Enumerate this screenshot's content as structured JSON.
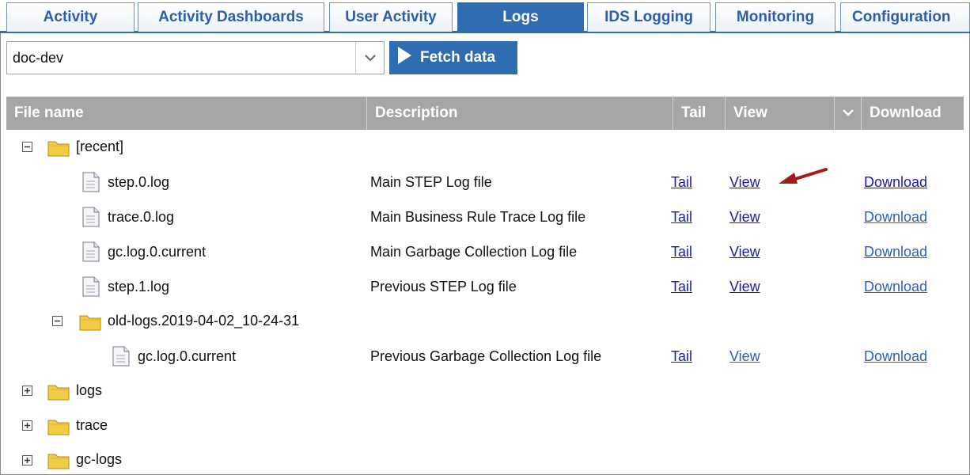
{
  "tabs": [
    {
      "label": "Activity",
      "active": false
    },
    {
      "label": "Activity Dashboards",
      "active": false
    },
    {
      "label": "User Activity",
      "active": false
    },
    {
      "label": "Logs",
      "active": true
    },
    {
      "label": "IDS Logging",
      "active": false
    },
    {
      "label": "Monitoring",
      "active": false
    },
    {
      "label": "Configuration",
      "active": false
    }
  ],
  "toolbar": {
    "server_value": "doc-dev",
    "fetch_label": "Fetch data"
  },
  "table": {
    "headers": {
      "file_name": "File name",
      "description": "Description",
      "tail": "Tail",
      "view": "View",
      "download": "Download"
    },
    "rows": [
      {
        "type": "folder",
        "expanded": true,
        "name": "[recent]"
      },
      {
        "type": "file",
        "name": "step.0.log",
        "description": "Main STEP Log file",
        "tail": "Tail",
        "view": "View",
        "download": "Download"
      },
      {
        "type": "file",
        "name": "trace.0.log",
        "description": "Main Business Rule Trace Log file",
        "tail": "Tail",
        "view": "View",
        "download": "Download"
      },
      {
        "type": "file",
        "name": "gc.log.0.current",
        "description": "Main Garbage Collection Log file",
        "tail": "Tail",
        "view": "View",
        "download": "Download"
      },
      {
        "type": "file",
        "name": "step.1.log",
        "description": "Previous STEP Log file",
        "tail": "Tail",
        "view": "View",
        "download": "Download"
      },
      {
        "type": "folder",
        "expanded": true,
        "name": "old-logs.2019-04-02_10-24-31"
      },
      {
        "type": "file",
        "name": "gc.log.0.current",
        "description": "Previous Garbage Collection Log file",
        "tail": "Tail",
        "view": "View",
        "download": "Download"
      },
      {
        "type": "folder",
        "expanded": false,
        "name": "logs"
      },
      {
        "type": "folder",
        "expanded": false,
        "name": "trace"
      },
      {
        "type": "folder",
        "expanded": false,
        "name": "gc-logs"
      }
    ]
  },
  "colors": {
    "accent": "#2f6db3",
    "header_bg": "#a6a6a6",
    "link": "#1a1aa6",
    "annotation_arrow": "#a31b1b"
  },
  "icons": {
    "folder": "folder-icon",
    "file": "file-icon",
    "collapse": "minus-box-icon",
    "expand": "plus-box-icon",
    "play": "play-icon",
    "dropdown": "chevron-down-icon"
  }
}
